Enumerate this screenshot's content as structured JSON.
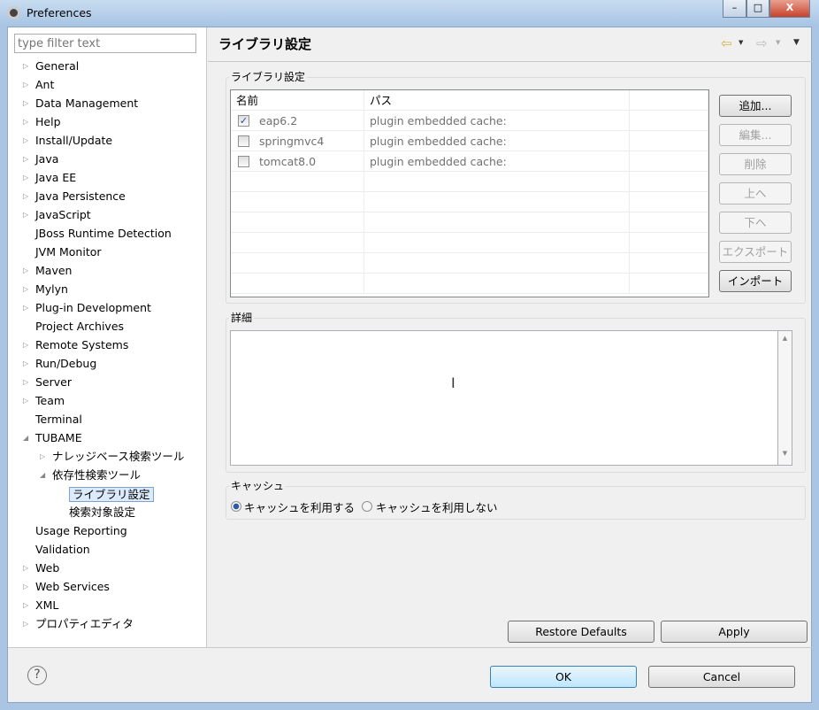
{
  "window": {
    "title": "Preferences",
    "minimize": "–",
    "maximize": "□",
    "close": "X"
  },
  "filter": {
    "placeholder": "type filter text"
  },
  "tree": [
    {
      "label": "General",
      "level": 0,
      "arrow": "▷"
    },
    {
      "label": "Ant",
      "level": 0,
      "arrow": "▷"
    },
    {
      "label": "Data Management",
      "level": 0,
      "arrow": "▷"
    },
    {
      "label": "Help",
      "level": 0,
      "arrow": "▷"
    },
    {
      "label": "Install/Update",
      "level": 0,
      "arrow": "▷"
    },
    {
      "label": "Java",
      "level": 0,
      "arrow": "▷"
    },
    {
      "label": "Java EE",
      "level": 0,
      "arrow": "▷"
    },
    {
      "label": "Java Persistence",
      "level": 0,
      "arrow": "▷"
    },
    {
      "label": "JavaScript",
      "level": 0,
      "arrow": "▷"
    },
    {
      "label": "JBoss Runtime Detection",
      "level": 0,
      "arrow": ""
    },
    {
      "label": "JVM Monitor",
      "level": 0,
      "arrow": ""
    },
    {
      "label": "Maven",
      "level": 0,
      "arrow": "▷"
    },
    {
      "label": "Mylyn",
      "level": 0,
      "arrow": "▷"
    },
    {
      "label": "Plug-in Development",
      "level": 0,
      "arrow": "▷"
    },
    {
      "label": "Project Archives",
      "level": 0,
      "arrow": ""
    },
    {
      "label": "Remote Systems",
      "level": 0,
      "arrow": "▷"
    },
    {
      "label": "Run/Debug",
      "level": 0,
      "arrow": "▷"
    },
    {
      "label": "Server",
      "level": 0,
      "arrow": "▷"
    },
    {
      "label": "Team",
      "level": 0,
      "arrow": "▷"
    },
    {
      "label": "Terminal",
      "level": 0,
      "arrow": ""
    },
    {
      "label": "TUBAME",
      "level": 0,
      "arrow": "◢"
    },
    {
      "label": "ナレッジベース検索ツール",
      "level": 1,
      "arrow": "▷"
    },
    {
      "label": "依存性検索ツール",
      "level": 1,
      "arrow": "◢"
    },
    {
      "label": "ライブラリ設定",
      "level": 2,
      "arrow": "",
      "selected": true
    },
    {
      "label": "検索対象設定",
      "level": 2,
      "arrow": ""
    },
    {
      "label": "Usage Reporting",
      "level": 0,
      "arrow": ""
    },
    {
      "label": "Validation",
      "level": 0,
      "arrow": ""
    },
    {
      "label": "Web",
      "level": 0,
      "arrow": "▷"
    },
    {
      "label": "Web Services",
      "level": 0,
      "arrow": "▷"
    },
    {
      "label": "XML",
      "level": 0,
      "arrow": "▷"
    },
    {
      "label": "プロパティエディタ",
      "level": 0,
      "arrow": "▷"
    }
  ],
  "page": {
    "title": "ライブラリ設定",
    "nav_back": "⇦",
    "nav_forward": "⇨",
    "dropdown": "▼"
  },
  "library": {
    "group_label": "ライブラリ設定",
    "columns": [
      "名前",
      "パス",
      ""
    ],
    "rows": [
      {
        "name": "eap6.2",
        "path": "plugin embedded cache:",
        "checked": true
      },
      {
        "name": "springmvc4",
        "path": "plugin embedded cache:",
        "checked": false
      },
      {
        "name": "tomcat8.0",
        "path": "plugin embedded cache:",
        "checked": false
      }
    ],
    "buttons": [
      {
        "label": "追加...",
        "enabled": true
      },
      {
        "label": "編集...",
        "enabled": false
      },
      {
        "label": "削除",
        "enabled": false
      },
      {
        "label": "上へ",
        "enabled": false
      },
      {
        "label": "下へ",
        "enabled": false
      },
      {
        "label": "エクスポート",
        "enabled": false
      },
      {
        "label": "インポート",
        "enabled": true
      }
    ]
  },
  "details": {
    "group_label": "詳細",
    "value": ""
  },
  "cache": {
    "group_label": "キャッシュ",
    "options": [
      {
        "label": "キャッシュを利用する",
        "selected": true
      },
      {
        "label": "キャッシュを利用しない",
        "selected": false
      }
    ]
  },
  "actions": {
    "restore_defaults": "Restore Defaults",
    "apply": "Apply",
    "ok": "OK",
    "cancel": "Cancel",
    "help": "?"
  }
}
